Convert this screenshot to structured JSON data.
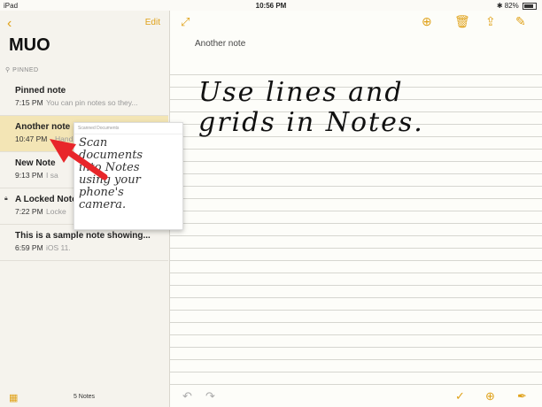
{
  "status": {
    "device": "iPad",
    "time": "10:56 PM",
    "battery": "82%"
  },
  "sidebar": {
    "edit_label": "Edit",
    "folder_title": "MUO",
    "pinned_label": "PINNED",
    "notes": [
      {
        "title": "Pinned note",
        "time": "7:15 PM",
        "preview": "You can pin notes so they..."
      },
      {
        "title": "Another note",
        "time": "10:47 PM",
        "preview": "Hand"
      },
      {
        "title": "New Note",
        "time": "9:13 PM",
        "preview": "I sa"
      },
      {
        "title": "A Locked Note",
        "time": "7:22 PM",
        "preview": "Locke"
      },
      {
        "title": "This is a sample note showing...",
        "time": "6:59 PM",
        "preview": "iOS 11."
      }
    ],
    "note_count": "5 Notes"
  },
  "popup": {
    "header": "Scanned Documents",
    "handwriting": "Scan\ndocuments\ninto Notes\nusing your\nphone's\ncamera."
  },
  "main": {
    "note_title": "Another note",
    "handwriting": "Use lines and\ngrids in Notes."
  },
  "colors": {
    "accent": "#e0a21a",
    "selected_row": "#f3e5b5",
    "arrow": "#e8262a"
  }
}
